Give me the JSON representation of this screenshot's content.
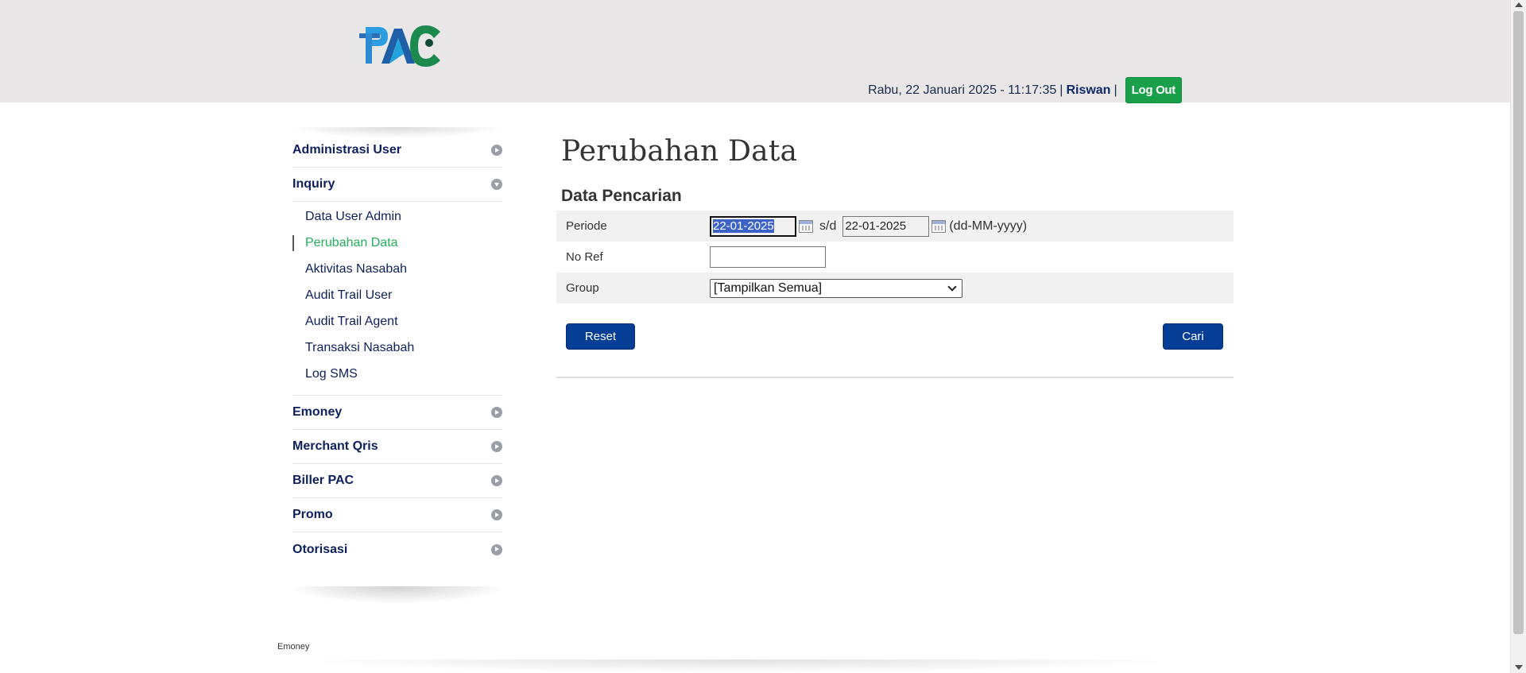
{
  "header": {
    "logo_text": "PAC",
    "datetime": "Rabu, 22 Januari 2025 - 11:17:35",
    "separator": "|",
    "username": "Riswan",
    "logout_label": "Log Out"
  },
  "sidebar": {
    "items": [
      {
        "label": "Administrasi User",
        "expanded": false
      },
      {
        "label": "Inquiry",
        "expanded": true,
        "children": [
          {
            "label": "Data User Admin"
          },
          {
            "label": "Perubahan Data",
            "active": true
          },
          {
            "label": "Aktivitas Nasabah"
          },
          {
            "label": "Audit Trail User"
          },
          {
            "label": "Audit Trail Agent"
          },
          {
            "label": "Transaksi Nasabah"
          },
          {
            "label": "Log SMS"
          }
        ]
      },
      {
        "label": "Emoney",
        "expanded": false
      },
      {
        "label": "Merchant Qris",
        "expanded": false
      },
      {
        "label": "Biller PAC",
        "expanded": false
      },
      {
        "label": "Promo",
        "expanded": false
      },
      {
        "label": "Otorisasi",
        "expanded": false
      }
    ]
  },
  "main": {
    "title": "Perubahan Data",
    "section_title": "Data Pencarian",
    "form": {
      "periode_label": "Periode",
      "date_from": "22-01-2025",
      "range_sep": "s/d",
      "date_to": "22-01-2025",
      "date_format_hint": "(dd-MM-yyyy)",
      "noref_label": "No Ref",
      "noref_value": "",
      "group_label": "Group",
      "group_selected": "[Tampilkan Semua]"
    },
    "reset_label": "Reset",
    "search_label": "Cari"
  },
  "footer": {
    "text": "Emoney"
  },
  "colors": {
    "header_bg": "#e8e6e7",
    "brand_blue": "#063e96",
    "brand_green": "#1aa04a",
    "active_menu": "#22b05a",
    "menu_text": "#0d1f5c"
  }
}
